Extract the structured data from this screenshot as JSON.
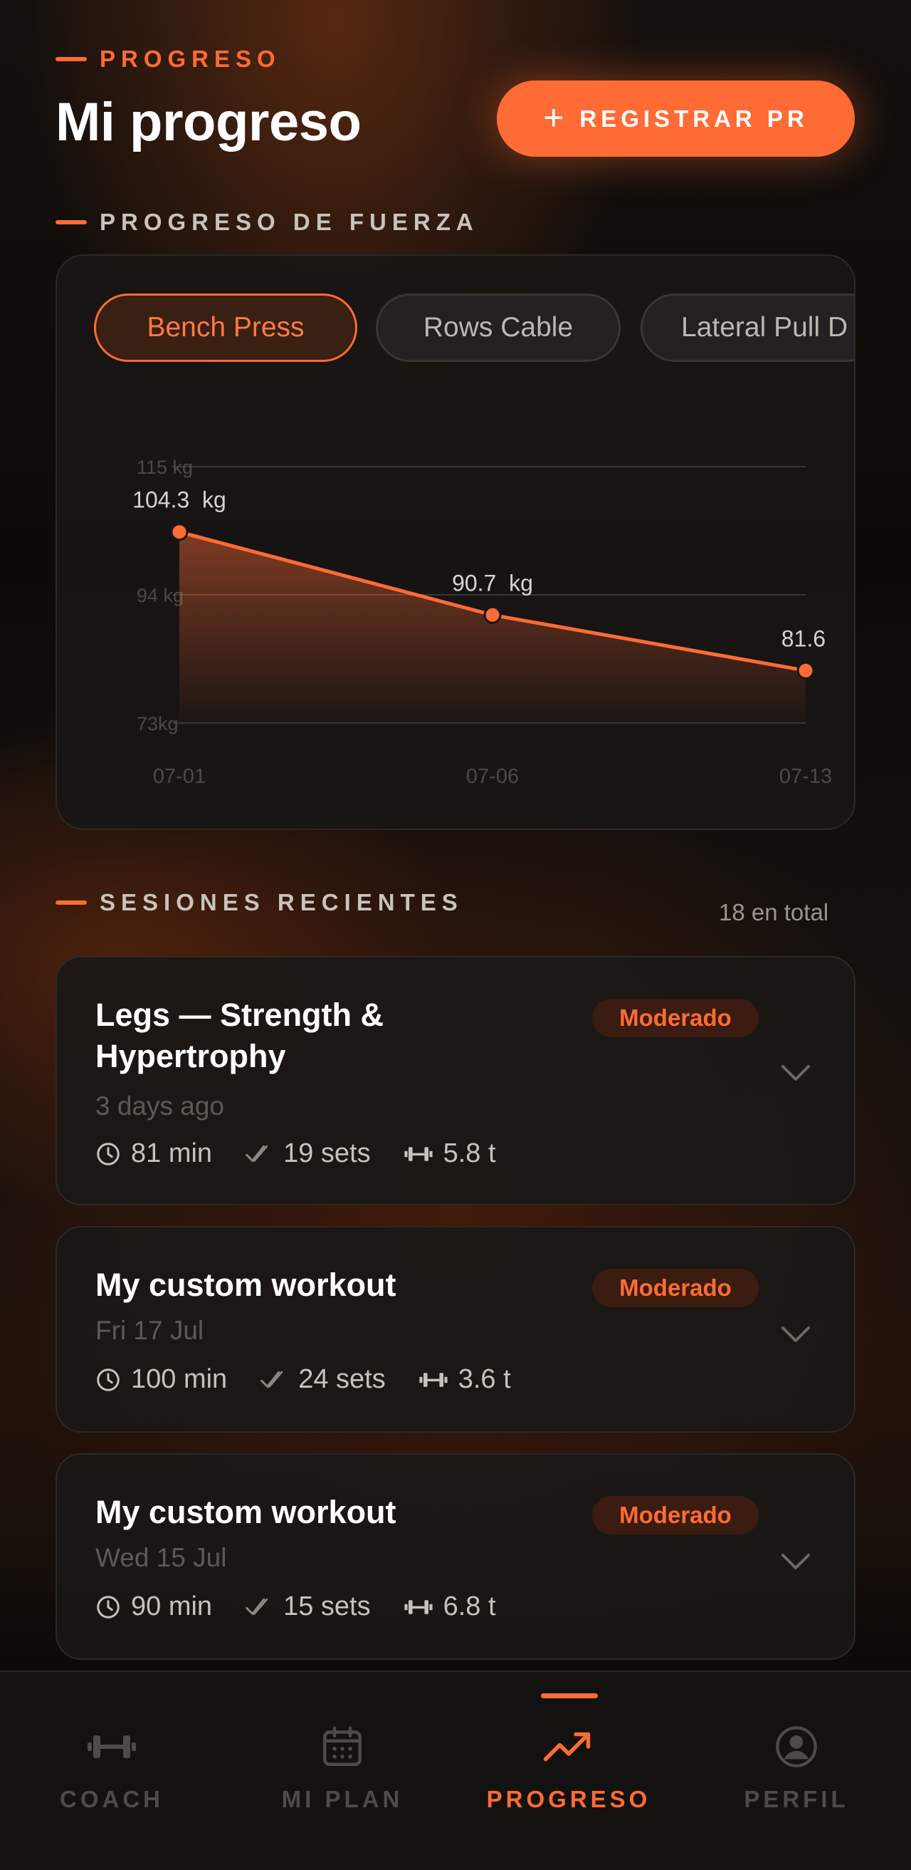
{
  "colors": {
    "accent": "#ff6b35",
    "background": "#0b0a09",
    "card": "#1a1715",
    "text_primary": "#ffffff",
    "text_muted": "#9d9590"
  },
  "header": {
    "eyebrow": "PROGRESO",
    "title": "Mi progreso",
    "register_button": {
      "icon": "plus-icon",
      "label": "REGISTRAR PR"
    }
  },
  "strength_section": {
    "label": "PROGRESO DE FUERZA",
    "chips": [
      {
        "label": "Bench Press",
        "active": true
      },
      {
        "label": "Rows Cable",
        "active": false
      },
      {
        "label": "Lateral Pull D",
        "active": false
      }
    ]
  },
  "chart_data": {
    "type": "area",
    "y_ticks": [
      "115 kg",
      "94 kg",
      "73kg"
    ],
    "x_ticks": [
      "07-01",
      "07-06",
      "07-13"
    ],
    "ylim": [
      73,
      115
    ],
    "unit": "kg",
    "grid": true,
    "points": [
      {
        "x": "07-01",
        "y": 104.3,
        "label": "104.3  kg"
      },
      {
        "x": "07-06",
        "y": 90.7,
        "label": "90.7  kg"
      },
      {
        "x": "07-13",
        "y": 81.6,
        "label": "81.6"
      }
    ]
  },
  "sessions_section": {
    "label": "SESIONES RECIENTES",
    "count": "18 en total",
    "sessions": [
      {
        "title": "Legs — Strength & Hypertrophy",
        "badge": "Moderado",
        "date": "3 days ago",
        "duration": "81 min",
        "sets": "19 sets",
        "volume": "5.8 t"
      },
      {
        "title": "My custom workout",
        "badge": "Moderado",
        "date": "Fri 17 Jul",
        "duration": "100 min",
        "sets": "24 sets",
        "volume": "3.6 t"
      },
      {
        "title": "My custom workout",
        "badge": "Moderado",
        "date": "Wed 15 Jul",
        "duration": "90 min",
        "sets": "15 sets",
        "volume": "6.8 t"
      }
    ]
  },
  "nav": {
    "items": [
      {
        "label": "COACH",
        "icon": "dumbbell-icon",
        "active": false
      },
      {
        "label": "MI PLAN",
        "icon": "calendar-icon",
        "active": false
      },
      {
        "label": "PROGRESO",
        "icon": "trending-up-icon",
        "active": true
      },
      {
        "label": "PERFIL",
        "icon": "user-icon",
        "active": false
      }
    ]
  }
}
